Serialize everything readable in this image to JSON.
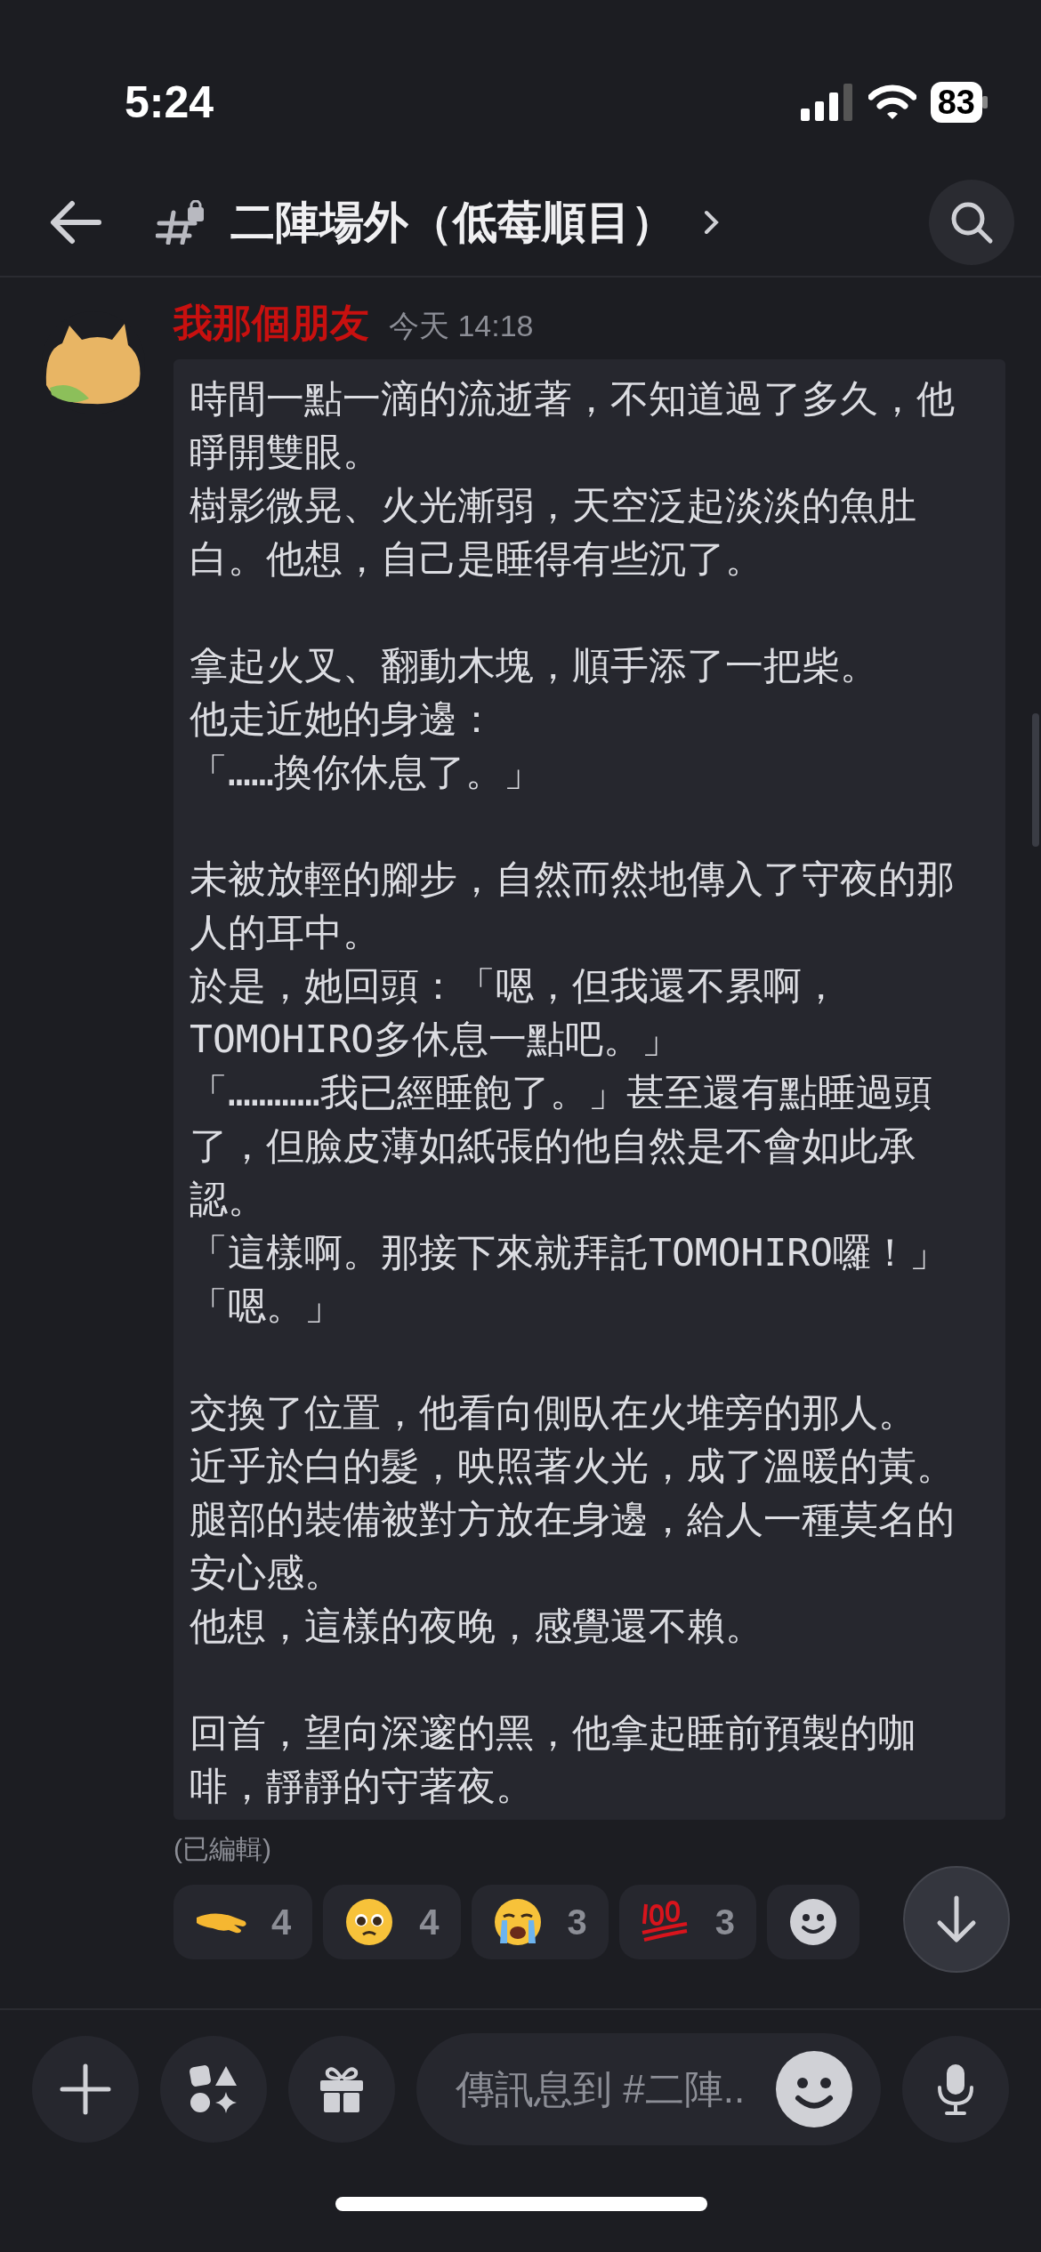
{
  "status_bar": {
    "time": "5:24",
    "battery": "83"
  },
  "header": {
    "channel": "二陣場外（低莓順目）"
  },
  "message": {
    "author": "我那個朋友",
    "timestamp": "今天 14:18",
    "paragraphs": [
      [
        "時間一點一滴的流逝著，不知道過了多久，他睜開雙眼。",
        "樹影微晃、火光漸弱，天空泛起淡淡的魚肚白。他想，自己是睡得有些沉了。"
      ],
      [
        "拿起火叉、翻動木塊，順手添了一把柴。",
        "他走近她的身邊：",
        "「……換你休息了。」"
      ],
      [
        "未被放輕的腳步，自然而然地傳入了守夜的那人的耳中。",
        "於是，她回頭：「嗯，但我還不累啊，TOMOHIRO多休息一點吧。」",
        "「…………我已經睡飽了。」甚至還有點睡過頭了，但臉皮薄如紙張的他自然是不會如此承認。",
        "「這樣啊。那接下來就拜託TOMOHIRO囉！」",
        "「嗯。」"
      ],
      [
        "交換了位置，他看向側臥在火堆旁的那人。",
        "近乎於白的髮，映照著火光，成了溫暖的黃。",
        "腿部的裝備被對方放在身邊，給人一種莫名的安心感。",
        "他想，這樣的夜晚，感覺還不賴。"
      ],
      [
        "回首，望向深邃的黑，他拿起睡前預製的咖啡，靜靜的守著夜。"
      ]
    ],
    "edited": "(已編輯)"
  },
  "reactions": [
    {
      "kind": "hand",
      "count": "4"
    },
    {
      "kind": "pleading",
      "count": "4"
    },
    {
      "kind": "crying",
      "count": "3"
    },
    {
      "kind": "hundred",
      "count": "3"
    }
  ],
  "composer": {
    "placeholder": "傳訊息到 #二陣.."
  }
}
